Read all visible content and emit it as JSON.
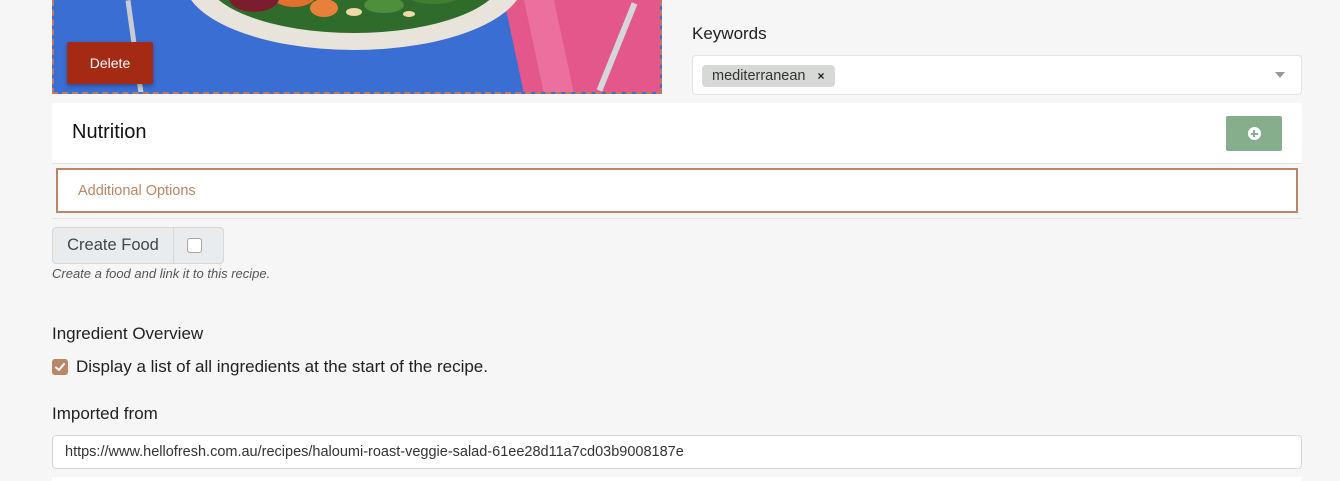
{
  "image": {
    "delete_label": "Delete"
  },
  "keywords": {
    "label": "Keywords",
    "selected": [
      {
        "label": "mediterranean",
        "remove": "×"
      }
    ]
  },
  "nutrition": {
    "title": "Nutrition",
    "add_icon": "plus-circle-icon"
  },
  "additional_options": {
    "label": "Additional Options"
  },
  "create_food": {
    "label": "Create Food",
    "checked": false,
    "help": "Create a food and link it to this recipe."
  },
  "ingredient_overview": {
    "label": "Ingredient Overview",
    "checkbox_label": "Display a list of all ingredients at the start of the recipe.",
    "checked": true
  },
  "imported_from": {
    "label": "Imported from",
    "value": "https://www.hellofresh.com.au/recipes/haloumi-roast-veggie-salad-61ee28d11a7cd03b9008187e"
  },
  "colors": {
    "accent": "#b98766",
    "danger": "#a42a13",
    "success": "#86ad8c"
  }
}
